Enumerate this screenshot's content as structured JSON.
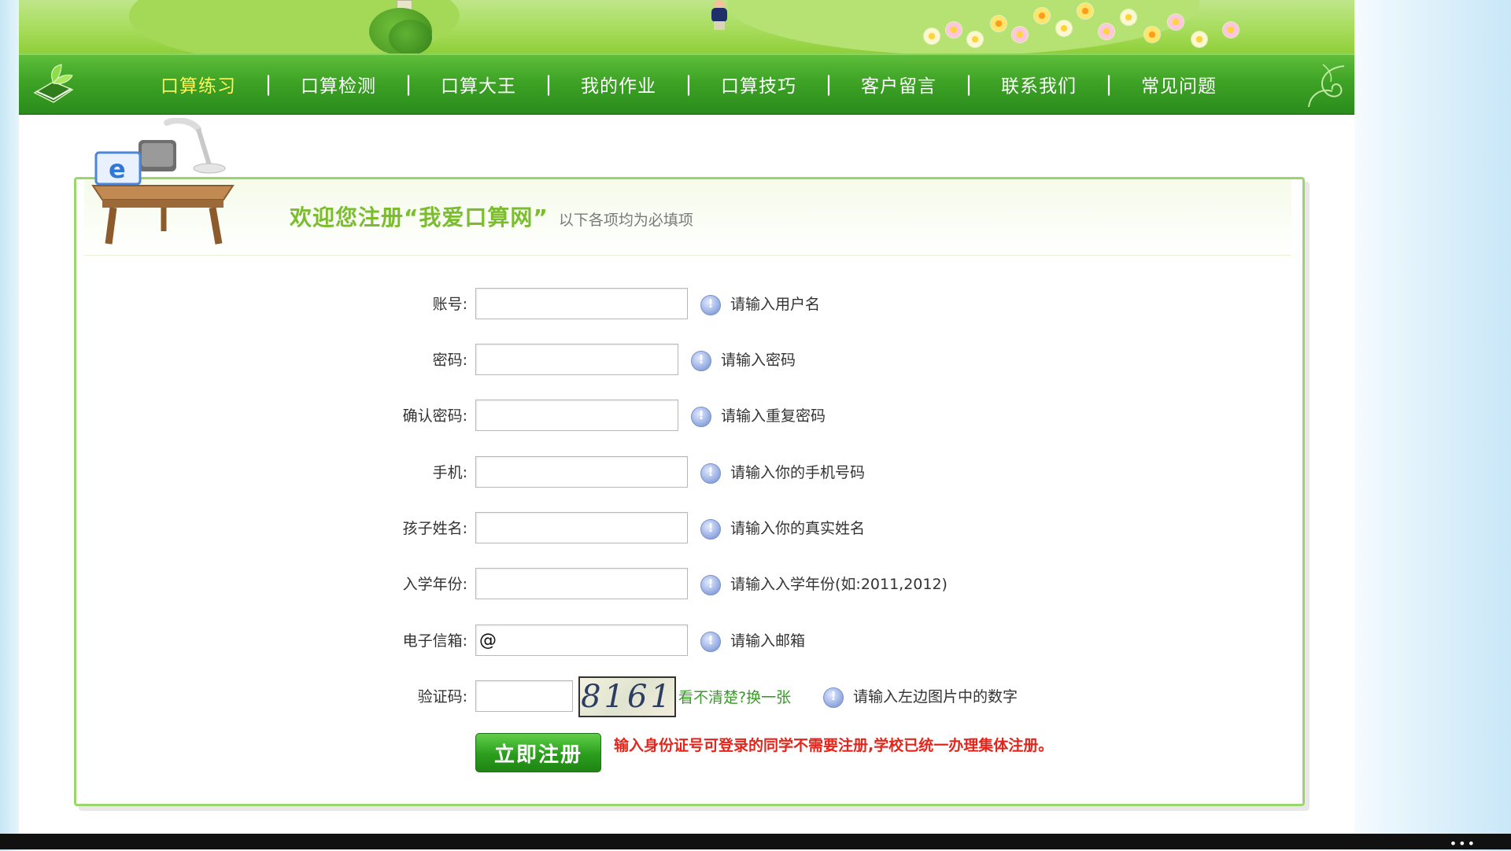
{
  "nav": {
    "items": [
      {
        "label": "口算练习",
        "active": true
      },
      {
        "label": "口算检测"
      },
      {
        "label": "口算大王"
      },
      {
        "label": "我的作业"
      },
      {
        "label": "口算技巧"
      },
      {
        "label": "客户留言"
      },
      {
        "label": "联系我们"
      },
      {
        "label": "常见问题"
      }
    ],
    "separator": "|"
  },
  "form": {
    "welcome": "欢迎您注册“我爱口算网”",
    "subtitle": "以下各项均为必填项",
    "fields": [
      {
        "label": "账号:",
        "value": "",
        "hint": "请输入用户名"
      },
      {
        "label": "密码:",
        "value": "",
        "hint": "请输入密码"
      },
      {
        "label": "确认密码:",
        "value": "",
        "hint": "请输入重复密码"
      },
      {
        "label": "手机:",
        "value": "",
        "hint": "请输入你的手机号码"
      },
      {
        "label": "孩子姓名:",
        "value": "",
        "hint": "请输入你的真实姓名"
      },
      {
        "label": "入学年份:",
        "value": "",
        "hint": "请输入入学年份(如:2011,2012)"
      },
      {
        "label": "电子信箱:",
        "value": "@",
        "hint": "请输入邮箱"
      },
      {
        "label": "验证码:",
        "value": "",
        "hint": "请输入左边图片中的数字"
      }
    ],
    "captcha_text": "8161",
    "refresh_label": "看不清楚?换一张",
    "submit_label": "立即注册",
    "notice": "输入身份证号可登录的同学不需要注册,学校已统一办理集体注册。"
  },
  "colors": {
    "nav_green": "#3ea326",
    "active_nav": "#fff45a",
    "welcome_green": "#7bbd2f",
    "notice_red": "#e4251b",
    "panel_border": "#9bd66a"
  },
  "window": {
    "more_menu": "•••"
  }
}
